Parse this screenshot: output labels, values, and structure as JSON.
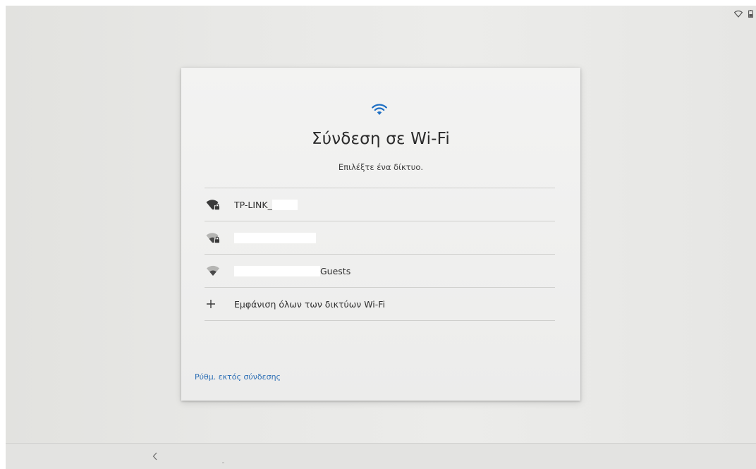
{
  "status_bar": {
    "icons": [
      "wifi-outline-icon",
      "battery-icon"
    ]
  },
  "dialog": {
    "header_icon": "wifi-icon",
    "title": "Σύνδεση σε Wi-Fi",
    "subtitle": "Επιλέξτε ένα δίκτυο.",
    "networks": [
      {
        "name": "TP-LINK_",
        "icon": "wifi-lock-icon",
        "signal": "strong",
        "redacted": true
      },
      {
        "name": "",
        "icon": "wifi-lock-icon",
        "signal": "weak",
        "redacted": true
      },
      {
        "name": "Guests",
        "icon": "wifi-icon",
        "signal": "medium",
        "redacted": true
      }
    ],
    "show_all": {
      "icon": "plus-icon",
      "label": "Εμφάνιση όλων των δικτύων Wi-Fi"
    },
    "offline_setup_link": "Ρύθμ. εκτός σύνδεσης"
  },
  "nav_bar": {
    "back_icon": "chevron-left-icon"
  },
  "colors": {
    "accent": "#2d6fb5",
    "wifi_header": "#1e6fc4",
    "card": "#f1f1f0",
    "background": "#e8e8e6"
  }
}
